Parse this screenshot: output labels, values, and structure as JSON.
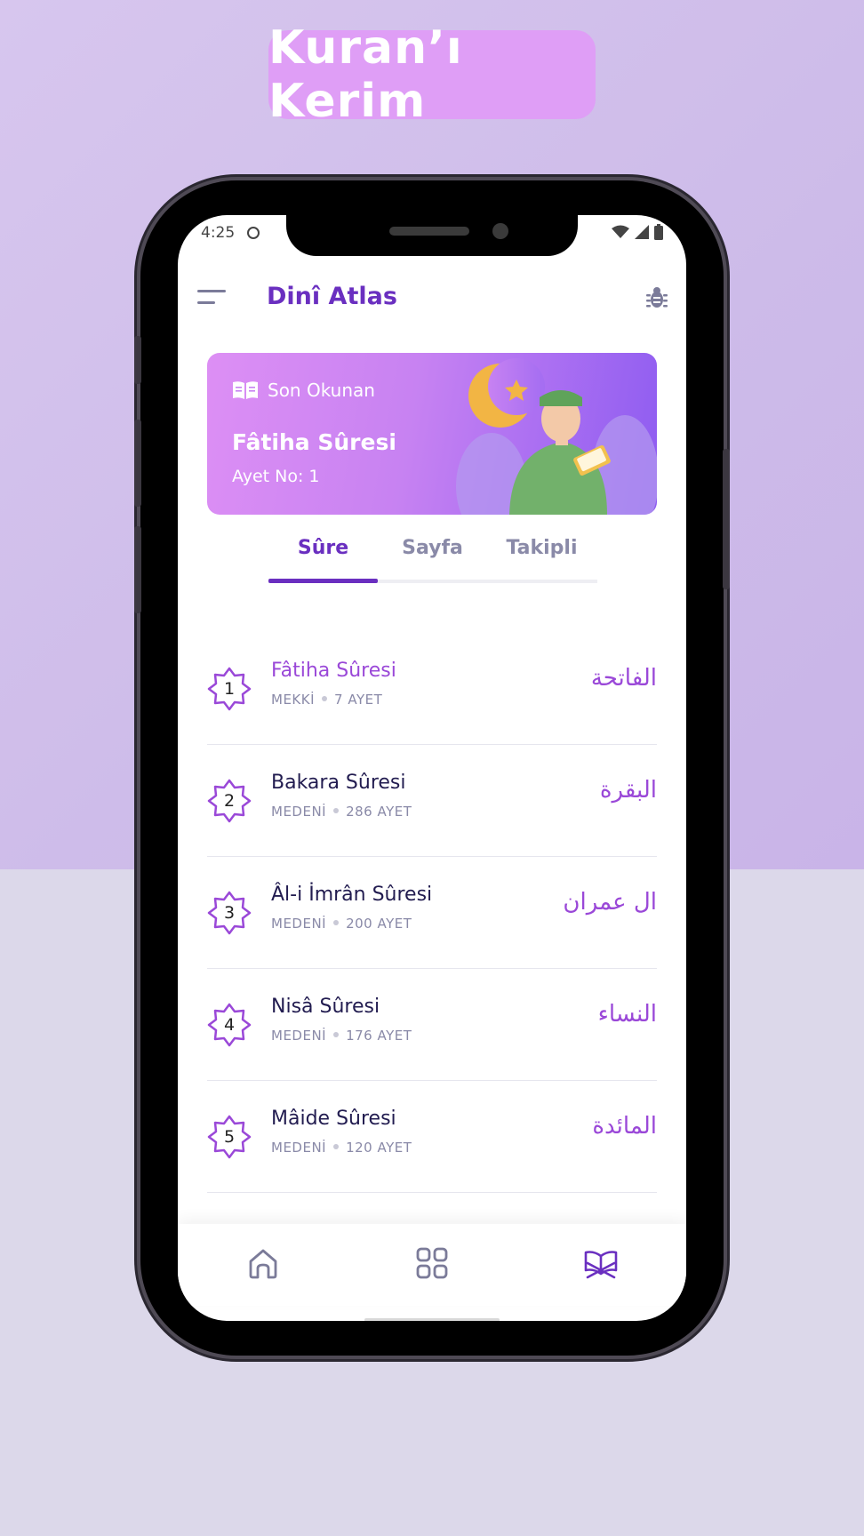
{
  "promo": {
    "title": "Kuran’ı Kerim"
  },
  "status_bar": {
    "time": "4:25"
  },
  "app_bar": {
    "title": "Dinî Atlas"
  },
  "last_read": {
    "label": "Son Okunan",
    "surah": "Fâtiha Sûresi",
    "ayah": "Ayet No: 1"
  },
  "tabs": [
    {
      "label": "Sûre",
      "active": true
    },
    {
      "label": "Sayfa",
      "active": false
    },
    {
      "label": "Takipli",
      "active": false
    }
  ],
  "surahs": [
    {
      "number": "1",
      "name": "Fâtiha Sûresi",
      "type": "MEKKİ",
      "ayah_count": "7 AYET",
      "arabic": "الفاتحة"
    },
    {
      "number": "2",
      "name": "Bakara Sûresi",
      "type": "MEDENİ",
      "ayah_count": "286 AYET",
      "arabic": "البقرة"
    },
    {
      "number": "3",
      "name": "Âl-i İmrân Sûresi",
      "type": "MEDENİ",
      "ayah_count": "200 AYET",
      "arabic": "ال عمران"
    },
    {
      "number": "4",
      "name": "Nisâ Sûresi",
      "type": "MEDENİ",
      "ayah_count": "176 AYET",
      "arabic": "النساء"
    },
    {
      "number": "5",
      "name": "Mâide Sûresi",
      "type": "MEDENİ",
      "ayah_count": "120 AYET",
      "arabic": "المائدة"
    }
  ],
  "bottom_nav": [
    {
      "icon": "home-icon"
    },
    {
      "icon": "grid-icon"
    },
    {
      "icon": "quran-icon"
    }
  ],
  "colors": {
    "accent": "#6a2fc0",
    "highlight": "#9a48d8",
    "muted": "#8a8aa8"
  }
}
